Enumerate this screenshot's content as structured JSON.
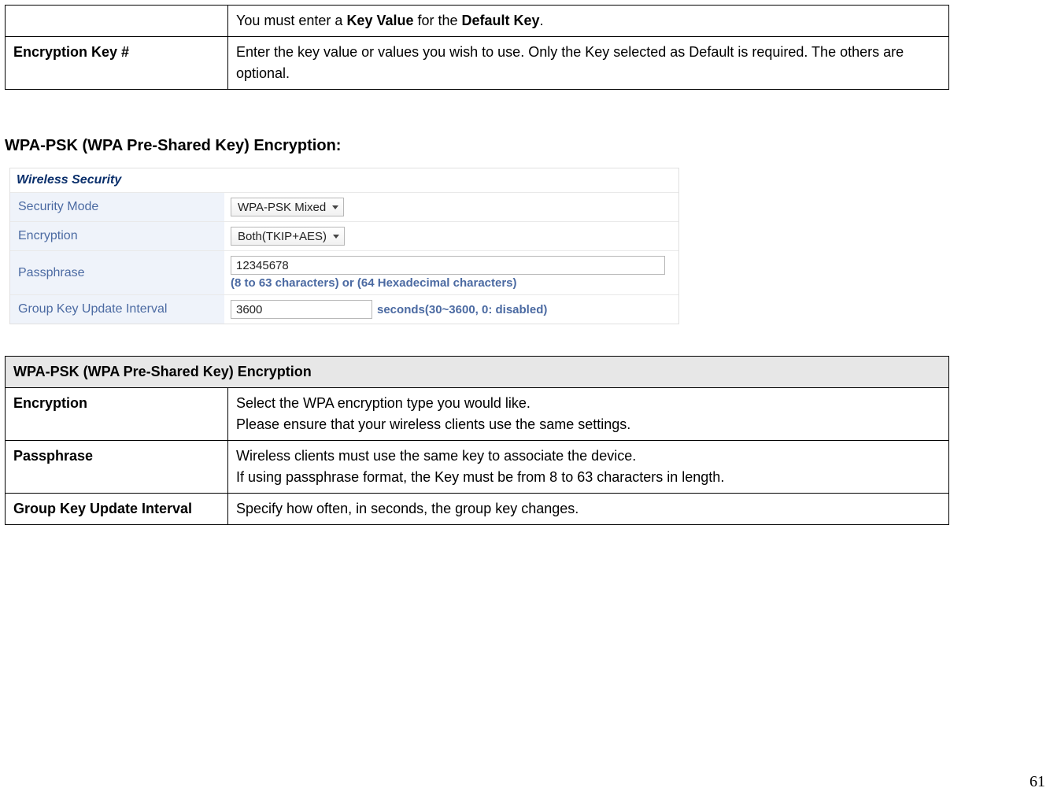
{
  "table1": {
    "row0": {
      "label": "",
      "desc_before": "You must enter a ",
      "desc_bold1": "Key Value",
      "desc_mid": " for the ",
      "desc_bold2": "Default Key",
      "desc_after": "."
    },
    "row1": {
      "label": "Encryption Key #",
      "desc": "Enter the key value or values you wish to use. Only the Key selected as Default is required. The others are optional."
    }
  },
  "section_heading": "WPA-PSK (WPA Pre-Shared Key) Encryption:",
  "ui": {
    "title": "Wireless Security",
    "rows": {
      "security_mode": {
        "label": "Security Mode",
        "value": "WPA-PSK Mixed"
      },
      "encryption": {
        "label": "Encryption",
        "value": "Both(TKIP+AES)"
      },
      "passphrase": {
        "label": "Passphrase",
        "value": "12345678",
        "hint": "(8 to 63 characters) or (64 Hexadecimal characters)"
      },
      "group_key": {
        "label": "Group Key Update Interval",
        "value": "3600",
        "hint": "seconds(30~3600, 0: disabled)"
      }
    }
  },
  "table2": {
    "header": "WPA-PSK (WPA Pre-Shared Key) Encryption",
    "rows": {
      "encryption": {
        "label": "Encryption",
        "desc_line1": "Select the WPA encryption type you would like.",
        "desc_line2": "Please ensure that your wireless clients use the same settings."
      },
      "passphrase": {
        "label": "Passphrase",
        "desc_line1": "Wireless clients must use the same key to associate the device.",
        "desc_line2": "If using passphrase format, the Key must be from 8 to 63 characters in length."
      },
      "group_key": {
        "label": "Group Key Update Interval",
        "desc": "Specify how often, in seconds, the group key changes."
      }
    }
  },
  "page_number": "61"
}
